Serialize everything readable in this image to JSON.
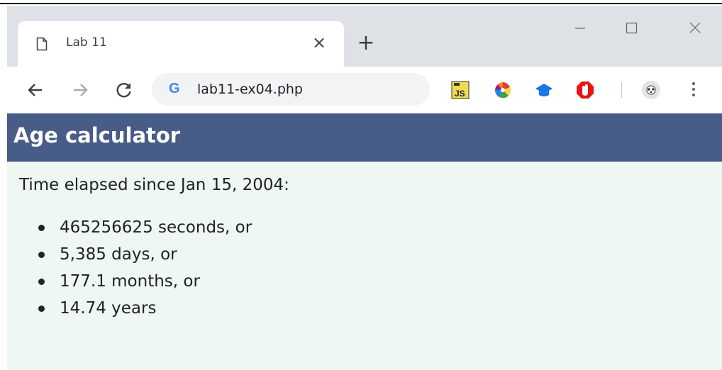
{
  "browser": {
    "tab": {
      "title": "Lab 11",
      "close": "×"
    },
    "new_tab": "+",
    "window_controls": {
      "minimize": "—",
      "maximize": "☐",
      "close": "✕"
    },
    "omnibox": {
      "url": "lab11-ex04.php",
      "google_mark": "G"
    },
    "extensions": [
      "js-extension-icon",
      "color-picker-icon",
      "graduation-cap-icon",
      "adblock-icon"
    ],
    "profile": "avatar-icon"
  },
  "page": {
    "title": "Age calculator",
    "intro": "Time elapsed since Jan 15, 2004:",
    "results": [
      "465256625 seconds, or",
      "5,385 days, or",
      "177.1 months, or",
      "14.74 years"
    ],
    "colors": {
      "header": "#475c87",
      "background": "#eef7f2",
      "header_text": "#ffffff"
    }
  }
}
